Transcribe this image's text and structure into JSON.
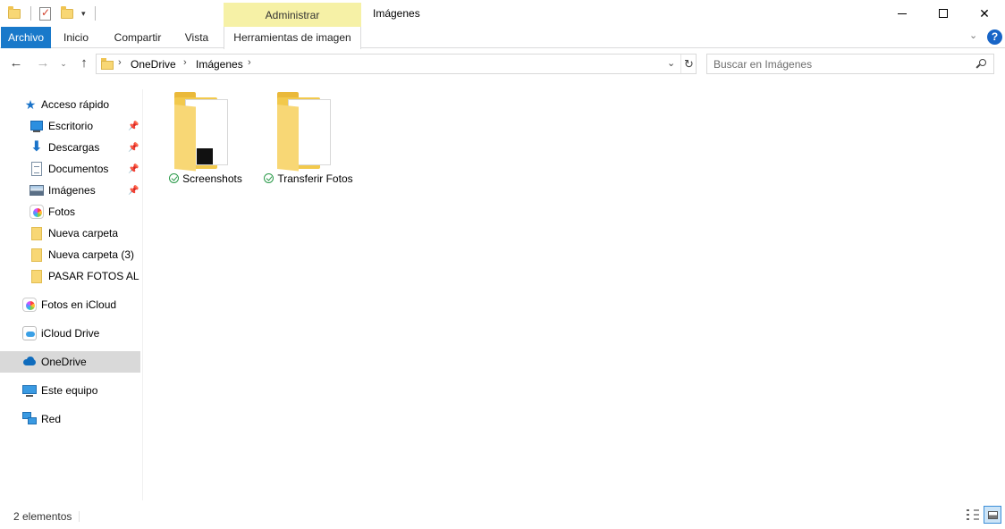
{
  "window": {
    "title": "Imágenes",
    "context_group": "Administrar"
  },
  "quick_access_toolbar": {
    "icons": [
      "folder-icon",
      "properties-icon",
      "new-folder-icon",
      "customize-dropdown-icon"
    ]
  },
  "ribbon": {
    "tabs": [
      {
        "label": "Archivo"
      },
      {
        "label": "Inicio"
      },
      {
        "label": "Compartir"
      },
      {
        "label": "Vista"
      },
      {
        "label": "Herramientas de imagen"
      }
    ],
    "help_label": "?"
  },
  "address_bar": {
    "crumbs": [
      "OneDrive",
      "Imágenes"
    ]
  },
  "search": {
    "placeholder": "Buscar en Imágenes"
  },
  "nav_pane": {
    "quick_access": "Acceso rápido",
    "pinned": [
      {
        "label": "Escritorio",
        "icon": "desktop-icon"
      },
      {
        "label": "Descargas",
        "icon": "downloads-icon"
      },
      {
        "label": "Documentos",
        "icon": "documents-icon"
      },
      {
        "label": "Imágenes",
        "icon": "pictures-icon"
      }
    ],
    "recent": [
      {
        "label": "Fotos",
        "icon": "photos-icon"
      },
      {
        "label": "Nueva carpeta",
        "icon": "folder-icon"
      },
      {
        "label": "Nueva carpeta (3)",
        "icon": "folder-icon"
      },
      {
        "label": "PASAR FOTOS AL IP",
        "icon": "folder-icon"
      }
    ],
    "locations": [
      {
        "label": "Fotos en iCloud",
        "icon": "icloud-photos-icon"
      },
      {
        "label": "iCloud Drive",
        "icon": "icloud-drive-icon"
      },
      {
        "label": "OneDrive",
        "icon": "onedrive-icon",
        "selected": true
      },
      {
        "label": "Este equipo",
        "icon": "this-pc-icon"
      },
      {
        "label": "Red",
        "icon": "network-icon"
      }
    ]
  },
  "content": {
    "items": [
      {
        "name": "Screenshots",
        "status": "synced"
      },
      {
        "name": "Transferir Fotos",
        "status": "synced"
      }
    ]
  },
  "status_bar": {
    "count": "2 elementos"
  },
  "colors": {
    "file_tab": "#1979ca",
    "context_tab": "#f6f1a6",
    "selection": "#d9d9d9",
    "sync_ok": "#2b9a4a"
  }
}
